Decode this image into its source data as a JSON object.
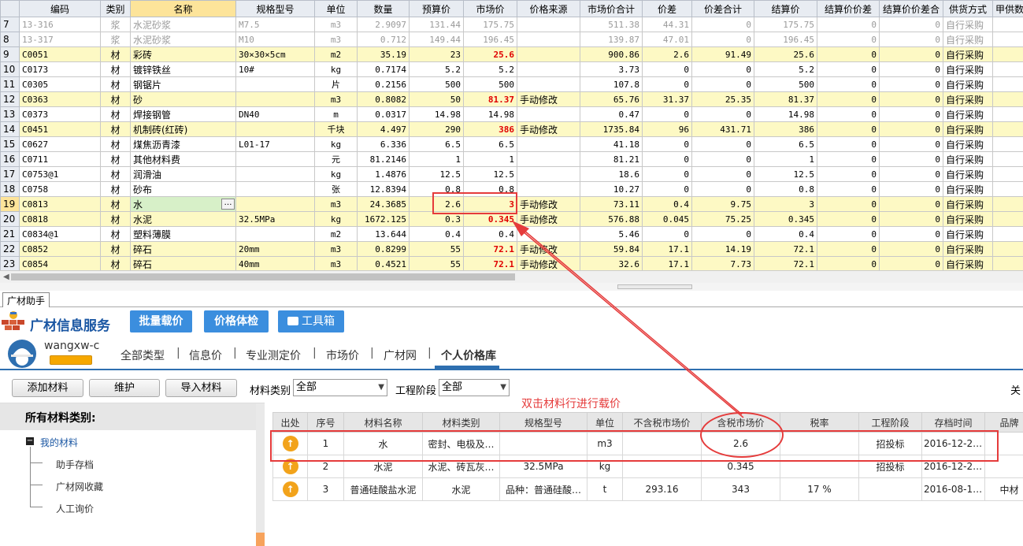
{
  "grid": {
    "columns": [
      "编码",
      "类别",
      "名称",
      "规格型号",
      "单位",
      "数量",
      "预算价",
      "市场价",
      "价格来源",
      "市场价合计",
      "价差",
      "价差合计",
      "结算价",
      "结算价价差",
      "结算价价差合",
      "供货方式",
      "甲供数量"
    ],
    "rows": [
      {
        "n": "7",
        "code": "13-316",
        "cat": "浆",
        "name": "水泥砂浆",
        "spec": "M7.5",
        "unit": "m3",
        "qty": "2.9097",
        "budget": "131.44",
        "market": "175.75",
        "source": "",
        "mtotal": "511.38",
        "diff": "44.31",
        "difftotal": "0",
        "settle": "175.75",
        "sdiff": "0",
        "sdifftotal": "0",
        "supply": "自行采购",
        "style": "grey"
      },
      {
        "n": "8",
        "code": "13-317",
        "cat": "浆",
        "name": "水泥砂浆",
        "spec": "M10",
        "unit": "m3",
        "qty": "0.712",
        "budget": "149.44",
        "market": "196.45",
        "source": "",
        "mtotal": "139.87",
        "diff": "47.01",
        "difftotal": "0",
        "settle": "196.45",
        "sdiff": "0",
        "sdifftotal": "0",
        "supply": "自行采购",
        "style": "grey"
      },
      {
        "n": "9",
        "code": "C0051",
        "cat": "材",
        "name": "彩砖",
        "spec": "30×30×5cm",
        "unit": "m2",
        "qty": "35.19",
        "budget": "23",
        "market": "25.6",
        "source": "",
        "mtotal": "900.86",
        "diff": "2.6",
        "difftotal": "91.49",
        "settle": "25.6",
        "sdiff": "0",
        "sdifftotal": "0",
        "supply": "自行采购",
        "style": "yellow",
        "red": true
      },
      {
        "n": "10",
        "code": "C0173",
        "cat": "材",
        "name": "镀锌铁丝",
        "spec": "10#",
        "unit": "kg",
        "qty": "0.7174",
        "budget": "5.2",
        "market": "5.2",
        "source": "",
        "mtotal": "3.73",
        "diff": "0",
        "difftotal": "0",
        "settle": "5.2",
        "sdiff": "0",
        "sdifftotal": "0",
        "supply": "自行采购",
        "style": ""
      },
      {
        "n": "11",
        "code": "C0305",
        "cat": "材",
        "name": "钢锯片",
        "spec": "",
        "unit": "片",
        "qty": "0.2156",
        "budget": "500",
        "market": "500",
        "source": "",
        "mtotal": "107.8",
        "diff": "0",
        "difftotal": "0",
        "settle": "500",
        "sdiff": "0",
        "sdifftotal": "0",
        "supply": "自行采购",
        "style": ""
      },
      {
        "n": "12",
        "code": "C0363",
        "cat": "材",
        "name": "砂",
        "spec": "",
        "unit": "m3",
        "qty": "0.8082",
        "budget": "50",
        "market": "81.37",
        "source": "手动修改",
        "mtotal": "65.76",
        "diff": "31.37",
        "difftotal": "25.35",
        "settle": "81.37",
        "sdiff": "0",
        "sdifftotal": "0",
        "supply": "自行采购",
        "style": "yellow",
        "red": true
      },
      {
        "n": "13",
        "code": "C0373",
        "cat": "材",
        "name": "焊接钢管",
        "spec": "DN40",
        "unit": "m",
        "qty": "0.0317",
        "budget": "14.98",
        "market": "14.98",
        "source": "",
        "mtotal": "0.47",
        "diff": "0",
        "difftotal": "0",
        "settle": "14.98",
        "sdiff": "0",
        "sdifftotal": "0",
        "supply": "自行采购",
        "style": ""
      },
      {
        "n": "14",
        "code": "C0451",
        "cat": "材",
        "name": "机制砖(红砖)",
        "spec": "",
        "unit": "千块",
        "qty": "4.497",
        "budget": "290",
        "market": "386",
        "source": "手动修改",
        "mtotal": "1735.84",
        "diff": "96",
        "difftotal": "431.71",
        "settle": "386",
        "sdiff": "0",
        "sdifftotal": "0",
        "supply": "自行采购",
        "style": "yellow",
        "red": true
      },
      {
        "n": "15",
        "code": "C0627",
        "cat": "材",
        "name": "煤焦沥青漆",
        "spec": "L01-17",
        "unit": "kg",
        "qty": "6.336",
        "budget": "6.5",
        "market": "6.5",
        "source": "",
        "mtotal": "41.18",
        "diff": "0",
        "difftotal": "0",
        "settle": "6.5",
        "sdiff": "0",
        "sdifftotal": "0",
        "supply": "自行采购",
        "style": ""
      },
      {
        "n": "16",
        "code": "C0711",
        "cat": "材",
        "name": "其他材料费",
        "spec": "",
        "unit": "元",
        "qty": "81.2146",
        "budget": "1",
        "market": "1",
        "source": "",
        "mtotal": "81.21",
        "diff": "0",
        "difftotal": "0",
        "settle": "1",
        "sdiff": "0",
        "sdifftotal": "0",
        "supply": "自行采购",
        "style": ""
      },
      {
        "n": "17",
        "code": "C0753@1",
        "cat": "材",
        "name": "润滑油",
        "spec": "",
        "unit": "kg",
        "qty": "1.4876",
        "budget": "12.5",
        "market": "12.5",
        "source": "",
        "mtotal": "18.6",
        "diff": "0",
        "difftotal": "0",
        "settle": "12.5",
        "sdiff": "0",
        "sdifftotal": "0",
        "supply": "自行采购",
        "style": ""
      },
      {
        "n": "18",
        "code": "C0758",
        "cat": "材",
        "name": "砂布",
        "spec": "",
        "unit": "张",
        "qty": "12.8394",
        "budget": "0.8",
        "market": "0.8",
        "source": "",
        "mtotal": "10.27",
        "diff": "0",
        "difftotal": "0",
        "settle": "0.8",
        "sdiff": "0",
        "sdifftotal": "0",
        "supply": "自行采购",
        "style": ""
      },
      {
        "n": "19",
        "code": "C0813",
        "cat": "材",
        "name": "水",
        "spec": "",
        "unit": "m3",
        "qty": "24.3685",
        "budget": "2.6",
        "market": "3",
        "source": "手动修改",
        "mtotal": "73.11",
        "diff": "0.4",
        "difftotal": "9.75",
        "settle": "3",
        "sdiff": "0",
        "sdifftotal": "0",
        "supply": "自行采购",
        "style": "yellow",
        "red": true,
        "cur": true
      },
      {
        "n": "20",
        "code": "C0818",
        "cat": "材",
        "name": "水泥",
        "spec": "32.5MPa",
        "unit": "kg",
        "qty": "1672.125",
        "budget": "0.3",
        "market": "0.345",
        "source": "手动修改",
        "mtotal": "576.88",
        "diff": "0.045",
        "difftotal": "75.25",
        "settle": "0.345",
        "sdiff": "0",
        "sdifftotal": "0",
        "supply": "自行采购",
        "style": "yellow",
        "red": true
      },
      {
        "n": "21",
        "code": "C0834@1",
        "cat": "材",
        "name": "塑料薄膜",
        "spec": "",
        "unit": "m2",
        "qty": "13.644",
        "budget": "0.4",
        "market": "0.4",
        "source": "",
        "mtotal": "5.46",
        "diff": "0",
        "difftotal": "0",
        "settle": "0.4",
        "sdiff": "0",
        "sdifftotal": "0",
        "supply": "自行采购",
        "style": ""
      },
      {
        "n": "22",
        "code": "C0852",
        "cat": "材",
        "name": "碎石",
        "spec": "20mm",
        "unit": "m3",
        "qty": "0.8299",
        "budget": "55",
        "market": "72.1",
        "source": "手动修改",
        "mtotal": "59.84",
        "diff": "17.1",
        "difftotal": "14.19",
        "settle": "72.1",
        "sdiff": "0",
        "sdifftotal": "0",
        "supply": "自行采购",
        "style": "yellow",
        "red": true
      },
      {
        "n": "23",
        "code": "C0854",
        "cat": "材",
        "name": "碎石",
        "spec": "40mm",
        "unit": "m3",
        "qty": "0.4521",
        "budget": "55",
        "market": "72.1",
        "source": "手动修改",
        "mtotal": "32.6",
        "diff": "17.1",
        "difftotal": "7.73",
        "settle": "72.1",
        "sdiff": "0",
        "sdifftotal": "0",
        "supply": "自行采购",
        "style": "yellow",
        "red": true
      }
    ]
  },
  "panel": {
    "tab_label": "广材助手",
    "brand": "广材信息服务",
    "buttons": {
      "batch": "批量载价",
      "check": "价格体检",
      "toolbox": "工具箱"
    },
    "username": "wangxw-c",
    "nav": [
      "全部类型",
      "信息价",
      "专业测定价",
      "市场价",
      "广材网",
      "个人价格库"
    ],
    "nav_active": 5,
    "tools": {
      "add": "添加材料",
      "maintain": "维护",
      "import": "导入材料",
      "cat_label": "材料类别",
      "cat_value": "全部",
      "stage_label": "工程阶段",
      "stage_value": "全部",
      "right_label": "关"
    },
    "tree": {
      "header": "所有材料类别:",
      "root": "我的材料",
      "children": [
        "助手存档",
        "广材网收藏",
        "人工询价"
      ]
    },
    "lower": {
      "columns": [
        "出处",
        "序号",
        "材料名称",
        "材料类别",
        "规格型号",
        "单位",
        "不含税市场价",
        "含税市场价",
        "税率",
        "工程阶段",
        "存档时间",
        "品牌"
      ],
      "rows": [
        {
          "src": "↑",
          "no": "1",
          "name": "水",
          "cat": "密封、电极及…",
          "spec": "",
          "unit": "m3",
          "notax": "",
          "tax": "2.6",
          "rate": "",
          "stage": "招投标",
          "time": "2016-12-2…",
          "brand": ""
        },
        {
          "src": "↑",
          "no": "2",
          "name": "水泥",
          "cat": "水泥、砖瓦灰…",
          "spec": "32.5MPa",
          "unit": "kg",
          "notax": "",
          "tax": "0.345",
          "rate": "",
          "stage": "招投标",
          "time": "2016-12-2…",
          "brand": ""
        },
        {
          "src": "↑",
          "no": "3",
          "name": "普通硅酸盐水泥",
          "cat": "水泥",
          "spec": "品种：普通硅酸…",
          "unit": "t",
          "notax": "293.16",
          "tax": "343",
          "rate": "17 %",
          "stage": "",
          "time": "2016-08-1…",
          "brand": "中材"
        }
      ]
    },
    "annotation": "双击材料行进行载价"
  }
}
